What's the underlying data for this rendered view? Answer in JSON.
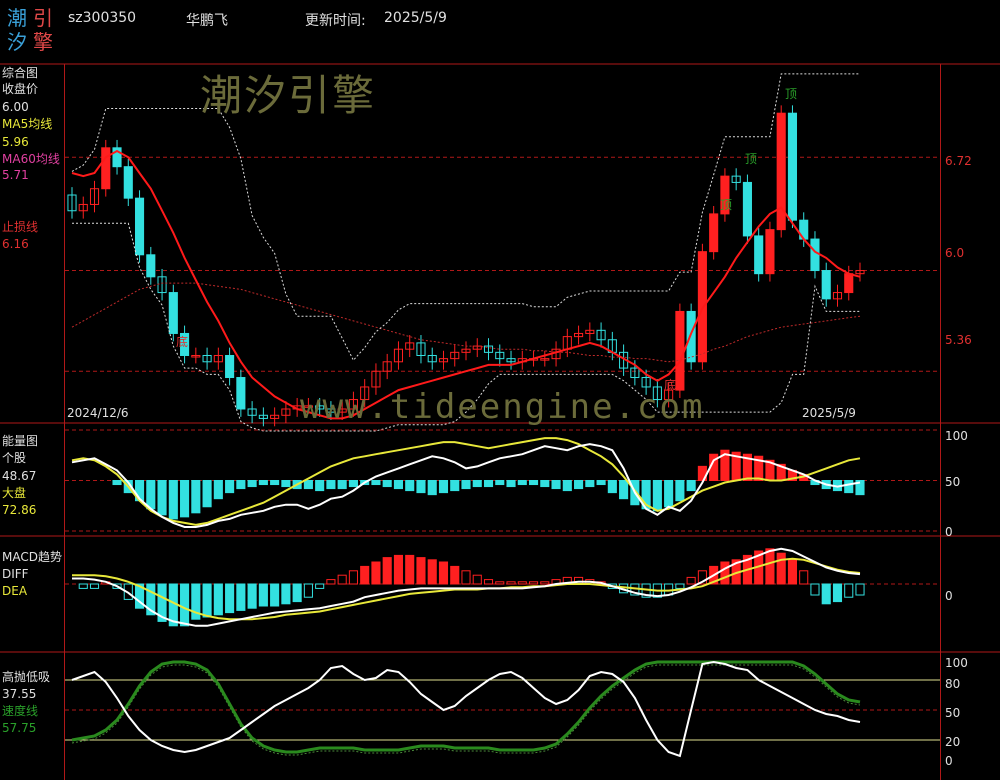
{
  "header": {
    "logo_chars": [
      "潮",
      "引",
      "汐",
      "擎"
    ],
    "code": "sz300350",
    "name": "华鹏飞",
    "update_label": "更新时间:",
    "update_date": "2025/5/9"
  },
  "watermarks": {
    "brand": "潮汐引擎",
    "url": "www.tideengine.com"
  },
  "panels": {
    "main": {
      "title": "综合图",
      "close_label": "收盘价",
      "close_value": "6.00",
      "ma5_label": "MA5均线",
      "ma5_value": "5.96",
      "ma60_label": "MA60均线",
      "ma60_value": "5.71",
      "stop_label": "止损线",
      "stop_value": "6.16",
      "right_ticks": [
        {
          "label": "6.72",
          "value": 6.72
        },
        {
          "label": "6.0",
          "value": 6.0
        },
        {
          "label": "5.36",
          "value": 5.36
        }
      ],
      "date_start": "2024/12/6",
      "date_end": "2025/5/9",
      "marks": {
        "top": "顶",
        "bottom": "底"
      }
    },
    "energy": {
      "title": "能量图",
      "stock_label": "个股",
      "stock_value": "48.67",
      "market_label": "大盘",
      "market_value": "72.86",
      "right_ticks": [
        "100",
        "50",
        "0"
      ]
    },
    "macd": {
      "title": "MACD趋势",
      "diff_label": "DIFF",
      "dea_label": "DEA",
      "right_ticks": [
        "0"
      ]
    },
    "absorb": {
      "title": "高抛低吸",
      "value1": "37.55",
      "speed_label": "速度线",
      "speed_value": "57.75",
      "right_ticks": [
        "100",
        "80",
        "50",
        "20",
        "0"
      ]
    }
  },
  "colors": {
    "up": "#ff2020",
    "down": "#33e0e0",
    "frame": "#b01818",
    "ma": "#ff1a1a",
    "ma60": "#c02a2a",
    "white": "#ffffff",
    "yellow": "#e8e83a",
    "green": "#2a8a1e",
    "label_red": "#e03030"
  },
  "chart_data": {
    "type": "candlestick",
    "x_range": [
      "2024/12/6",
      "2025/5/9"
    ],
    "ylim": [
      5.05,
      7.3
    ],
    "close": [
      6.38,
      6.42,
      6.52,
      6.78,
      6.66,
      6.46,
      6.1,
      5.96,
      5.86,
      5.6,
      5.46,
      5.46,
      5.42,
      5.46,
      5.32,
      5.12,
      5.08,
      5.06,
      5.08,
      5.12,
      5.14,
      5.14,
      5.12,
      5.1,
      5.12,
      5.18,
      5.26,
      5.36,
      5.42,
      5.5,
      5.54,
      5.46,
      5.42,
      5.44,
      5.48,
      5.5,
      5.52,
      5.48,
      5.44,
      5.42,
      5.44,
      5.44,
      5.44,
      5.5,
      5.58,
      5.6,
      5.62,
      5.56,
      5.48,
      5.38,
      5.32,
      5.26,
      5.18,
      5.24,
      5.74,
      5.42,
      6.12,
      6.36,
      6.6,
      6.56,
      6.22,
      5.98,
      6.26,
      7.0,
      6.32,
      6.2,
      6.0,
      5.82,
      5.86,
      5.98,
      6.0
    ],
    "ma5": [
      6.62,
      6.6,
      6.62,
      6.72,
      6.76,
      6.72,
      6.62,
      6.52,
      6.38,
      6.24,
      6.08,
      5.94,
      5.8,
      5.68,
      5.54,
      5.42,
      5.32,
      5.26,
      5.2,
      5.16,
      5.12,
      5.1,
      5.08,
      5.06,
      5.06,
      5.08,
      5.12,
      5.16,
      5.2,
      5.24,
      5.26,
      5.28,
      5.3,
      5.32,
      5.34,
      5.36,
      5.38,
      5.4,
      5.4,
      5.4,
      5.42,
      5.44,
      5.46,
      5.48,
      5.5,
      5.52,
      5.54,
      5.52,
      5.48,
      5.44,
      5.4,
      5.34,
      5.3,
      5.34,
      5.42,
      5.6,
      5.76,
      5.86,
      5.96,
      6.08,
      6.18,
      6.28,
      6.36,
      6.4,
      6.3,
      6.2,
      6.12,
      6.08,
      6.02,
      5.98,
      5.96
    ],
    "ma60": [
      5.64,
      5.68,
      5.72,
      5.76,
      5.8,
      5.84,
      5.88,
      5.9,
      5.92,
      5.92,
      5.92,
      5.92,
      5.91,
      5.9,
      5.89,
      5.88,
      5.86,
      5.84,
      5.82,
      5.8,
      5.78,
      5.76,
      5.74,
      5.72,
      5.7,
      5.68,
      5.66,
      5.64,
      5.62,
      5.6,
      5.58,
      5.56,
      5.55,
      5.54,
      5.53,
      5.52,
      5.52,
      5.51,
      5.5,
      5.5,
      5.5,
      5.49,
      5.49,
      5.48,
      5.48,
      5.47,
      5.46,
      5.46,
      5.45,
      5.45,
      5.44,
      5.44,
      5.43,
      5.42,
      5.43,
      5.45,
      5.47,
      5.5,
      5.52,
      5.55,
      5.58,
      5.6,
      5.62,
      5.64,
      5.65,
      5.66,
      5.67,
      5.68,
      5.69,
      5.7,
      5.71
    ],
    "energy": {
      "ylim": [
        0,
        100
      ],
      "stock": [
        68,
        70,
        72,
        66,
        60,
        48,
        32,
        22,
        14,
        8,
        4,
        4,
        6,
        10,
        12,
        16,
        18,
        20,
        24,
        26,
        26,
        22,
        26,
        32,
        34,
        40,
        48,
        54,
        58,
        62,
        66,
        70,
        74,
        72,
        68,
        62,
        64,
        68,
        72,
        74,
        76,
        80,
        84,
        82,
        80,
        84,
        86,
        84,
        80,
        62,
        38,
        22,
        16,
        24,
        20,
        30,
        48,
        70,
        76,
        74,
        72,
        70,
        68,
        64,
        60,
        56,
        50,
        46,
        44,
        46,
        48
      ],
      "market": [
        70,
        72,
        70,
        64,
        56,
        44,
        30,
        20,
        14,
        10,
        8,
        6,
        8,
        12,
        16,
        20,
        24,
        28,
        34,
        40,
        46,
        52,
        58,
        64,
        68,
        72,
        74,
        76,
        78,
        80,
        82,
        84,
        86,
        88,
        88,
        86,
        84,
        82,
        84,
        86,
        88,
        90,
        92,
        92,
        90,
        86,
        80,
        74,
        66,
        54,
        40,
        26,
        20,
        22,
        28,
        34,
        40,
        44,
        48,
        50,
        52,
        52,
        50,
        50,
        52,
        54,
        58,
        62,
        66,
        70,
        72
      ],
      "hist": [
        0,
        0,
        0,
        0,
        -4,
        -12,
        -20,
        -28,
        -34,
        -38,
        -36,
        -32,
        -26,
        -18,
        -12,
        -8,
        -6,
        -4,
        -4,
        -6,
        -8,
        -8,
        -10,
        -8,
        -8,
        -6,
        -4,
        -4,
        -6,
        -8,
        -10,
        -12,
        -14,
        -12,
        -10,
        -8,
        -6,
        -6,
        -4,
        -6,
        -4,
        -4,
        -6,
        -8,
        -10,
        -8,
        -6,
        -4,
        -12,
        -18,
        -24,
        -28,
        -30,
        -26,
        -20,
        -10,
        14,
        26,
        30,
        28,
        26,
        24,
        20,
        16,
        10,
        6,
        -4,
        -8,
        -10,
        -12,
        -14
      ]
    },
    "macd": {
      "ylim": [
        -0.6,
        0.4
      ],
      "diff": [
        0.05,
        0.05,
        0.04,
        0.02,
        -0.02,
        -0.08,
        -0.16,
        -0.24,
        -0.3,
        -0.34,
        -0.36,
        -0.38,
        -0.38,
        -0.36,
        -0.34,
        -0.32,
        -0.3,
        -0.28,
        -0.26,
        -0.25,
        -0.24,
        -0.23,
        -0.22,
        -0.2,
        -0.18,
        -0.16,
        -0.12,
        -0.1,
        -0.08,
        -0.06,
        -0.05,
        -0.04,
        -0.04,
        -0.04,
        -0.04,
        -0.04,
        -0.04,
        -0.04,
        -0.04,
        -0.04,
        -0.04,
        -0.03,
        -0.02,
        0.0,
        0.01,
        0.02,
        0.02,
        0.01,
        -0.02,
        -0.05,
        -0.08,
        -0.1,
        -0.11,
        -0.1,
        -0.07,
        -0.03,
        0.02,
        0.08,
        0.14,
        0.19,
        0.22,
        0.26,
        0.3,
        0.32,
        0.3,
        0.25,
        0.2,
        0.15,
        0.12,
        0.1,
        0.09
      ],
      "dea": [
        0.08,
        0.08,
        0.08,
        0.07,
        0.05,
        0.02,
        -0.02,
        -0.07,
        -0.12,
        -0.17,
        -0.22,
        -0.26,
        -0.29,
        -0.31,
        -0.32,
        -0.32,
        -0.32,
        -0.31,
        -0.3,
        -0.28,
        -0.27,
        -0.26,
        -0.25,
        -0.23,
        -0.21,
        -0.19,
        -0.17,
        -0.15,
        -0.13,
        -0.11,
        -0.09,
        -0.08,
        -0.07,
        -0.06,
        -0.05,
        -0.05,
        -0.05,
        -0.04,
        -0.04,
        -0.03,
        -0.03,
        -0.02,
        -0.02,
        -0.01,
        0.0,
        0.0,
        0.0,
        -0.01,
        -0.02,
        -0.03,
        -0.04,
        -0.05,
        -0.06,
        -0.06,
        -0.05,
        -0.04,
        -0.02,
        0.02,
        0.06,
        0.1,
        0.13,
        0.16,
        0.19,
        0.22,
        0.23,
        0.22,
        0.19,
        0.16,
        0.13,
        0.11,
        0.1
      ],
      "hist": [
        0,
        -0.04,
        -0.04,
        0.02,
        -0.04,
        -0.14,
        -0.22,
        -0.28,
        -0.34,
        -0.38,
        -0.38,
        -0.32,
        -0.3,
        -0.28,
        -0.26,
        -0.24,
        -0.22,
        -0.2,
        -0.2,
        -0.18,
        -0.16,
        -0.12,
        -0.04,
        0.04,
        0.08,
        0.12,
        0.16,
        0.2,
        0.24,
        0.26,
        0.26,
        0.24,
        0.22,
        0.2,
        0.16,
        0.12,
        0.08,
        0.04,
        0.02,
        0.02,
        0.02,
        0.02,
        0.02,
        0.04,
        0.06,
        0.06,
        0.04,
        0.02,
        -0.04,
        -0.08,
        -0.1,
        -0.12,
        -0.12,
        -0.1,
        -0.04,
        0.06,
        0.12,
        0.16,
        0.2,
        0.22,
        0.26,
        0.3,
        0.32,
        0.28,
        0.22,
        0.12,
        -0.1,
        -0.18,
        -0.16,
        -0.12,
        -0.1
      ]
    },
    "absorb": {
      "ylim": [
        0,
        100
      ],
      "white": [
        80,
        84,
        88,
        78,
        62,
        44,
        30,
        20,
        14,
        10,
        8,
        10,
        14,
        18,
        22,
        30,
        38,
        46,
        54,
        60,
        66,
        72,
        80,
        92,
        94,
        86,
        80,
        82,
        90,
        88,
        78,
        66,
        58,
        50,
        54,
        64,
        72,
        80,
        86,
        88,
        82,
        72,
        62,
        56,
        60,
        70,
        84,
        88,
        86,
        78,
        62,
        40,
        20,
        8,
        4,
        50,
        96,
        98,
        96,
        92,
        90,
        80,
        74,
        68,
        62,
        56,
        50,
        46,
        44,
        40,
        38
      ],
      "speed": [
        20,
        22,
        24,
        30,
        40,
        56,
        74,
        88,
        96,
        98,
        98,
        96,
        90,
        76,
        56,
        36,
        22,
        14,
        10,
        8,
        8,
        10,
        12,
        12,
        12,
        12,
        10,
        10,
        10,
        10,
        12,
        14,
        14,
        14,
        12,
        12,
        12,
        12,
        10,
        10,
        10,
        10,
        12,
        16,
        26,
        38,
        52,
        64,
        74,
        82,
        90,
        96,
        98,
        98,
        98,
        98,
        98,
        98,
        98,
        98,
        98,
        98,
        98,
        98,
        98,
        94,
        86,
        76,
        66,
        60,
        58
      ]
    }
  }
}
